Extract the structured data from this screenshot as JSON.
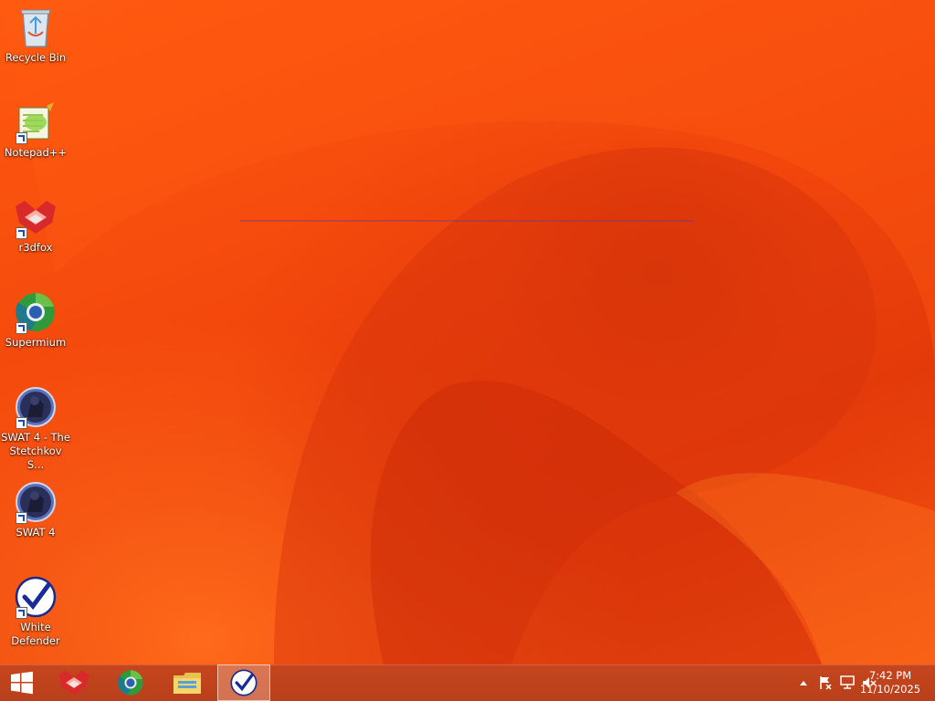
{
  "desktop": {
    "icons": [
      {
        "label": "Recycle Bin",
        "icon": "recycle-bin-icon"
      },
      {
        "label": "Notepad++",
        "icon": "notepad-plus-plus-icon"
      },
      {
        "label": "r3dfox",
        "icon": "r3dfox-icon"
      },
      {
        "label": "Supermium",
        "icon": "supermium-icon"
      },
      {
        "label": "SWAT 4 - The Stetchkov S...",
        "icon": "swat4-stetchkov-icon"
      },
      {
        "label": "SWAT 4",
        "icon": "swat4-icon"
      },
      {
        "label": "White Defender",
        "icon": "white-defender-icon"
      }
    ]
  },
  "taskbar": {
    "start": {
      "icon": "windows-logo-icon"
    },
    "pinned": [
      {
        "icon": "r3dfox-icon",
        "active": false
      },
      {
        "icon": "supermium-icon",
        "active": false
      },
      {
        "icon": "file-explorer-icon",
        "active": false
      },
      {
        "icon": "white-defender-icon",
        "active": true
      }
    ],
    "tray": {
      "icons": [
        "show-hidden-icons-chevron-icon",
        "action-center-flag-icon",
        "network-icon",
        "volume-muted-icon"
      ],
      "time": "7:42 PM",
      "date": "11/10/2025"
    }
  }
}
